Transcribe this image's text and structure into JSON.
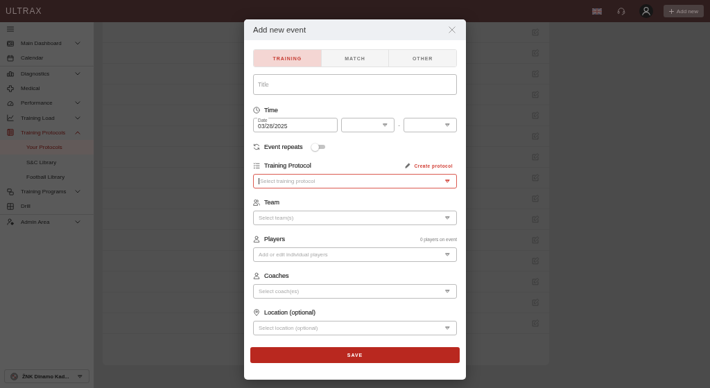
{
  "top_bar": {
    "logo": "ULTRAX",
    "add_button": "Add new"
  },
  "sidebar": {
    "sections": [
      {
        "items": [
          {
            "label": "Main Dashboard",
            "selected": false,
            "expanded": false
          },
          {
            "label": "Calendar",
            "selected": false
          }
        ]
      },
      {
        "items": [
          {
            "label": "Diagnostics",
            "selected": false,
            "expanded": false
          },
          {
            "label": "Medical",
            "selected": false
          },
          {
            "label": "Performance",
            "selected": false,
            "expanded": false
          },
          {
            "label": "Training Load",
            "selected": false,
            "expanded": false
          },
          {
            "label": "Training Protocols",
            "selected": true,
            "expanded": true,
            "children": [
              {
                "label": "Your Protocols",
                "selected": true
              },
              {
                "label": "S&C Library",
                "selected": false
              },
              {
                "label": "Football Library",
                "selected": false
              }
            ]
          },
          {
            "label": "Training Programs",
            "selected": false,
            "expanded": false
          },
          {
            "label": "Drill",
            "selected": false
          }
        ]
      },
      {
        "items": [
          {
            "label": "Admin Area",
            "selected": false,
            "expanded": false
          }
        ]
      }
    ],
    "team_selector": "ŽNK Dinamo Kad..."
  },
  "content": {
    "rows": [
      {
        "editable": true
      },
      {
        "editable": true
      },
      {
        "editable": true
      },
      {
        "editable": true
      },
      {
        "editable": true
      },
      {
        "editable": true
      },
      {
        "editable": true
      },
      {
        "editable": true
      },
      {
        "editable": true
      },
      {
        "editable": true
      },
      {
        "editable": true
      },
      {
        "editable": true
      },
      {
        "editable": true
      },
      {
        "editable": true
      },
      {
        "editable": true
      }
    ]
  },
  "dialog": {
    "title": "Add new event",
    "event_types": [
      {
        "label": "TRAINING",
        "selected": true
      },
      {
        "label": "MATCH",
        "selected": false
      },
      {
        "label": "OTHER",
        "selected": false
      }
    ],
    "title_field": {
      "placeholder": "Title"
    },
    "time": {
      "label": "Time",
      "date_label": "Date",
      "value": "03/28/2025",
      "separator": "-"
    },
    "repeat": {
      "label": "Event repeats",
      "on": false
    },
    "sections": [
      {
        "label": "Training Protocol",
        "link": "Create protocol",
        "placeholder": "Select training protocol",
        "focused": true
      },
      {
        "label": "Team",
        "placeholder": "Select team(s)",
        "focused": false
      },
      {
        "label": "Players",
        "note": "0 players on event",
        "placeholder": "Add or edit individual players",
        "focused": false
      },
      {
        "label": "Coaches",
        "placeholder": "Select coach(es)",
        "focused": false
      },
      {
        "label": "Location (optional)",
        "placeholder": "Select location (optional)",
        "focused": false
      }
    ],
    "save_button": "SAVE"
  }
}
